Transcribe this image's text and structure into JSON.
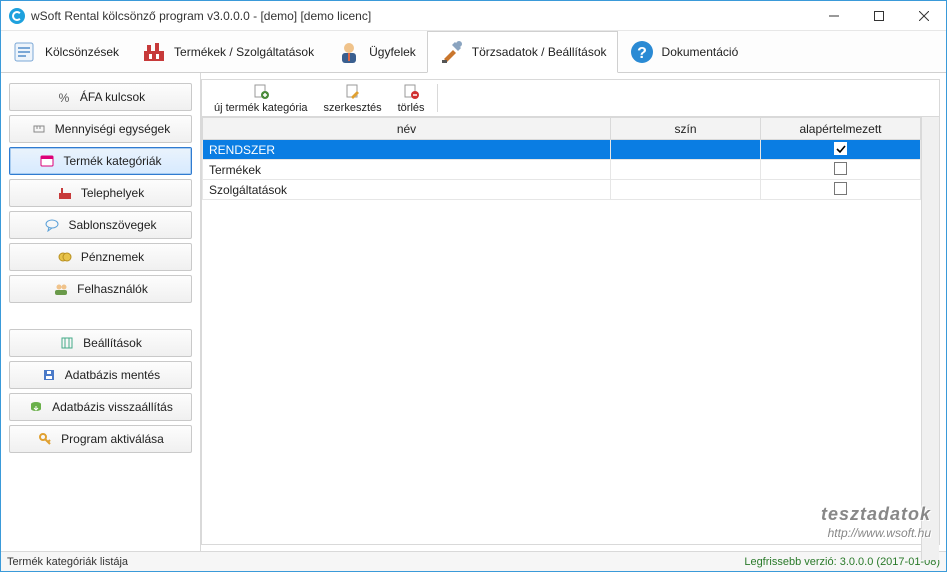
{
  "titlebar": {
    "title": "wSoft Rental kölcsönző program v3.0.0.0 - [demo] [demo licenc]"
  },
  "maintabs": {
    "rentals": "Kölcsönzések",
    "products": "Termékek / Szolgáltatások",
    "customers": "Ügyfelek",
    "masterdata": "Törzsadatok / Beállítások",
    "docs": "Dokumentáció"
  },
  "sidebar": {
    "vat_keys": "ÁFA kulcsok",
    "quantity_units": "Mennyiségi egységek",
    "product_categories": "Termék kategóriák",
    "sites": "Telephelyek",
    "templates": "Sablonszövegek",
    "currencies": "Pénznemek",
    "users": "Felhasználók",
    "settings": "Beállítások",
    "db_backup": "Adatbázis mentés",
    "db_restore": "Adatbázis visszaállítás",
    "activate": "Program aktiválása"
  },
  "content_toolbar": {
    "new": "új termék kategória",
    "edit": "szerkesztés",
    "delete": "törlés"
  },
  "grid": {
    "headers": {
      "name": "név",
      "color": "szín",
      "default": "alapértelmezett"
    },
    "rows": [
      {
        "name": "RENDSZER",
        "color": "",
        "default": true,
        "selected": true
      },
      {
        "name": "Termékek",
        "color": "",
        "default": false,
        "selected": false
      },
      {
        "name": "Szolgáltatások",
        "color": "",
        "default": false,
        "selected": false
      }
    ]
  },
  "watermark": {
    "line1": "tesztadatok",
    "line2": "http://www.wsoft.hu"
  },
  "statusbar": {
    "left": "Termék kategóriák listája",
    "right": "Legfrissebb verzió: 3.0.0.0 (2017-01-08)"
  }
}
